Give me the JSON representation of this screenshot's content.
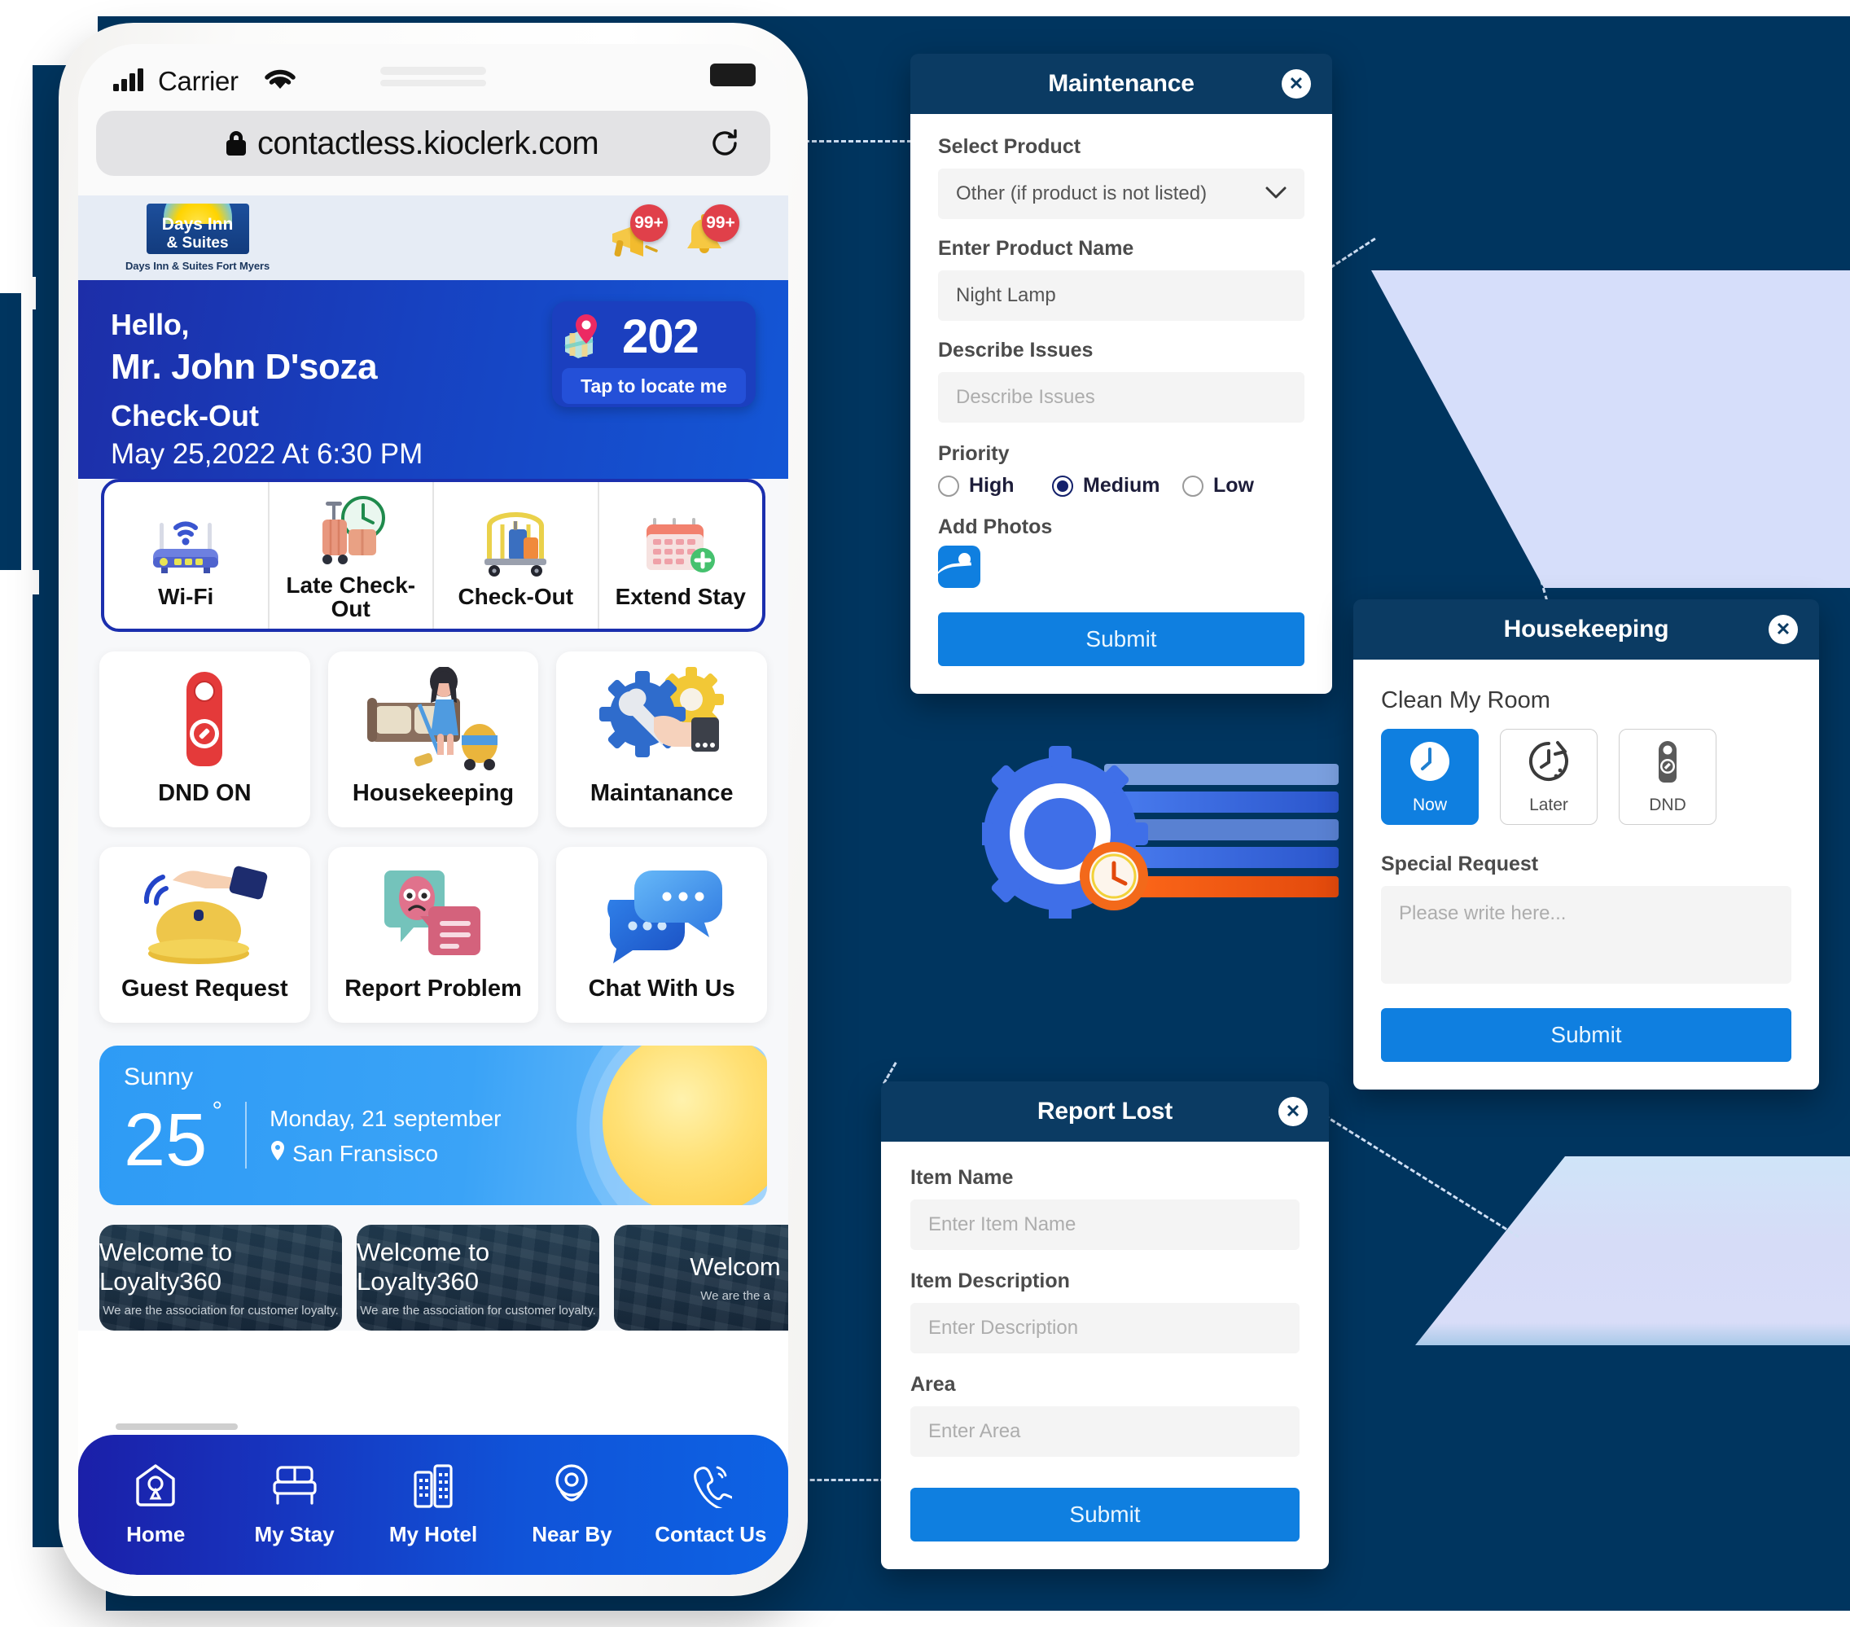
{
  "colors": {
    "backdrop_navy": "#00355f",
    "modal_header": "#0b3b63",
    "accent_blue": "#0f7fe0",
    "hero_blue": "#1741c0",
    "badge_red": "#e0404a",
    "decor_lightblue": "#d6defa"
  },
  "phone": {
    "statusbar": {
      "carrier": "Carrier",
      "wifi_icon": "wifi-icon",
      "battery_icon": "battery-icon"
    },
    "browser": {
      "lock_icon": "lock-icon",
      "url": "contactless.kioclerk.com",
      "reload_icon": "reload-icon"
    },
    "hotel_bar": {
      "logo_line1": "Days Inn",
      "logo_line2": "& Suites",
      "logo_caption": "Days Inn & Suites Fort Myers",
      "icons": [
        {
          "name": "megaphone-icon",
          "badge": "99+"
        },
        {
          "name": "bell-icon",
          "badge": "99+"
        }
      ]
    },
    "hero": {
      "greeting": "Hello,",
      "guest_name": "Mr. John D'soza",
      "checkout_label": "Check-Out",
      "checkout_value": "May 25,2022 At 6:30 PM",
      "room": {
        "pin_icon": "map-pin-icon",
        "number": "202",
        "cta": "Tap to locate me"
      }
    },
    "quick_actions": [
      {
        "label": "Wi-Fi",
        "icon": "router-icon"
      },
      {
        "label": "Late Check-Out",
        "icon": "luggage-clock-icon"
      },
      {
        "label": "Check-Out",
        "icon": "luggage-cart-icon"
      },
      {
        "label": "Extend Stay",
        "icon": "calendar-plus-icon"
      }
    ],
    "tiles": [
      {
        "label": "DND ON",
        "icon": "door-hanger-icon"
      },
      {
        "label": "Housekeeping",
        "icon": "cleaning-icon"
      },
      {
        "label": "Maintanance",
        "icon": "wrench-gear-icon"
      },
      {
        "label": "Guest Request",
        "icon": "service-bell-icon"
      },
      {
        "label": "Report Problem",
        "icon": "sad-chat-icon"
      },
      {
        "label": "Chat With Us",
        "icon": "chat-bubbles-icon"
      }
    ],
    "weather": {
      "condition": "Sunny",
      "temperature": "25",
      "degree_symbol": "°",
      "date": "Monday, 21 september",
      "location_icon": "location-pin-icon",
      "location": "San Fransisco",
      "sun_icon": "sun-icon"
    },
    "loyalty_cards": [
      {
        "title": "Welcome to Loyalty360",
        "subtitle": "We are the association for customer loyalty."
      },
      {
        "title": "Welcome to Loyalty360",
        "subtitle": "We are the association for customer loyalty."
      },
      {
        "title": "Welcom",
        "subtitle": "We are the a"
      }
    ],
    "bottom_nav": [
      {
        "label": "Home",
        "icon": "home-pin-icon"
      },
      {
        "label": "My Stay",
        "icon": "bed-icon"
      },
      {
        "label": "My Hotel",
        "icon": "buildings-icon"
      },
      {
        "label": "Near By",
        "icon": "location-pin-icon"
      },
      {
        "label": "Contact Us",
        "icon": "phone-call-icon"
      }
    ]
  },
  "maintenance_modal": {
    "title": "Maintenance",
    "close_icon": "close-icon",
    "select_product_label": "Select Product",
    "select_product_value": "Other (if product is not listed)",
    "chevron_icon": "chevron-down-icon",
    "product_name_label": "Enter Product Name",
    "product_name_value": "Night Lamp",
    "describe_label": "Describe Issues",
    "describe_placeholder": "Describe Issues",
    "priority_label": "Priority",
    "priority_options": [
      {
        "label": "High",
        "selected": false
      },
      {
        "label": "Medium",
        "selected": true
      },
      {
        "label": "Low",
        "selected": false
      }
    ],
    "add_photos_label": "Add Photos",
    "photo_icon": "add-image-icon",
    "submit_label": "Submit"
  },
  "housekeeping_modal": {
    "title": "Housekeeping",
    "close_icon": "close-icon",
    "section_title": "Clean My Room",
    "options": [
      {
        "label": "Now",
        "icon": "clock-icon",
        "selected": true
      },
      {
        "label": "Later",
        "icon": "clock-arrow-icon",
        "selected": false
      },
      {
        "label": "DND",
        "icon": "door-hanger-icon",
        "selected": false
      }
    ],
    "special_request_label": "Special Request",
    "special_request_placeholder": "Please write here...",
    "submit_label": "Submit"
  },
  "report_lost_modal": {
    "title": "Report Lost",
    "close_icon": "close-icon",
    "item_name_label": "Item Name",
    "item_name_placeholder": "Enter Item Name",
    "item_desc_label": "Item Description",
    "item_desc_placeholder": "Enter Description",
    "area_label": "Area",
    "area_placeholder": "Enter Area",
    "submit_label": "Submit"
  },
  "decor": {
    "gear_illustration": "gear-clock-illustration"
  }
}
